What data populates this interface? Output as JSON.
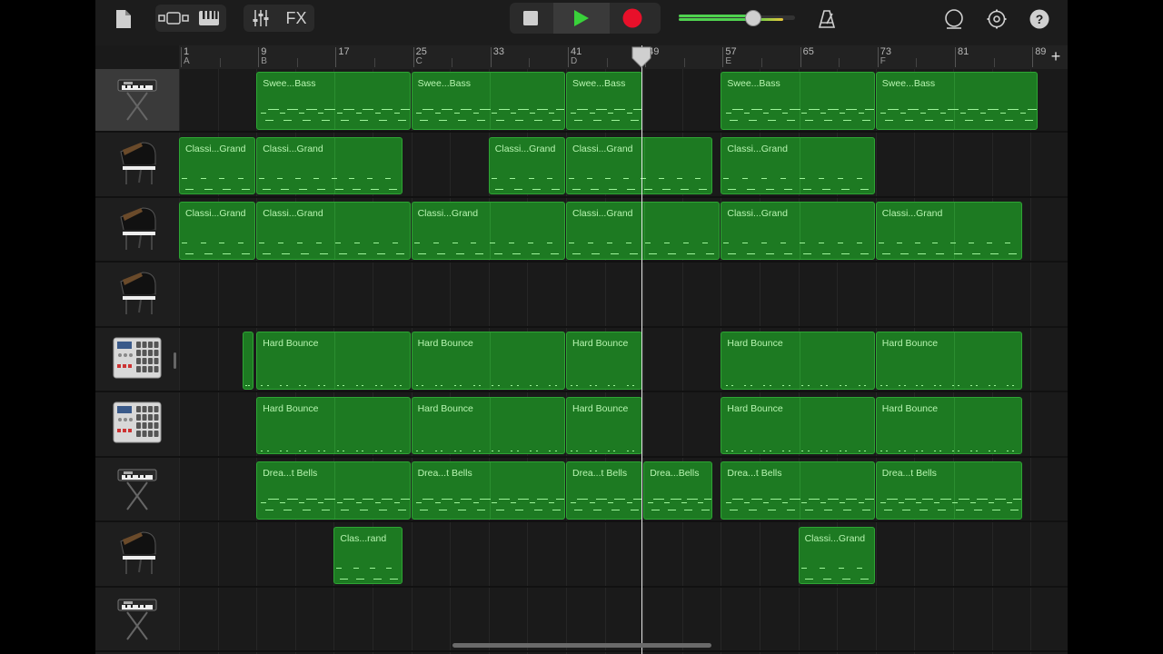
{
  "toolbar": {
    "fx_label": "FX"
  },
  "colors": {
    "region": "#1d7a22",
    "region_border": "#2ea534",
    "region_text": "#b7f5b0",
    "record": "#e8102a",
    "play": "#39d23a"
  },
  "volume_level": 0.63,
  "ruler": {
    "bars": [
      "1",
      "9",
      "17",
      "25",
      "33",
      "41",
      "49",
      "57",
      "65",
      "73",
      "81",
      "89"
    ],
    "markers": [
      "A",
      "B",
      "C",
      "D",
      "E",
      "F"
    ],
    "add_label": "+"
  },
  "tracks": [
    {
      "instrument": "keyboard-synth-icon",
      "regions": [
        {
          "name": "Swee...Bass"
        },
        {
          "name": "Swee...Bass"
        },
        {
          "name": "Swee...Bass"
        },
        {
          "name": "Swee...Bass"
        },
        {
          "name": "Swee...Bass"
        }
      ]
    },
    {
      "instrument": "grand-piano-icon",
      "regions": [
        {
          "name": "Classi...Grand"
        },
        {
          "name": "Classi...Grand"
        },
        {
          "name": "Classi...Grand"
        },
        {
          "name": "Classi...Grand"
        },
        {
          "name": "Classi...Grand"
        }
      ]
    },
    {
      "instrument": "grand-piano-icon",
      "regions": [
        {
          "name": "Classi...Grand"
        },
        {
          "name": "Classi...Grand"
        },
        {
          "name": "Classi...Grand"
        },
        {
          "name": "Classi...Grand"
        },
        {
          "name": "Classi...Grand"
        },
        {
          "name": "Classi...Grand"
        }
      ]
    },
    {
      "instrument": "grand-piano-icon",
      "regions": []
    },
    {
      "instrument": "drum-machine-icon",
      "regions": [
        {
          "name": ""
        },
        {
          "name": "Hard Bounce"
        },
        {
          "name": "Hard Bounce"
        },
        {
          "name": "Hard Bounce"
        },
        {
          "name": "Hard Bounce"
        },
        {
          "name": "Hard Bounce"
        }
      ]
    },
    {
      "instrument": "drum-machine-icon",
      "regions": [
        {
          "name": "Hard Bounce"
        },
        {
          "name": "Hard Bounce"
        },
        {
          "name": "Hard Bounce"
        },
        {
          "name": "Hard Bounce"
        },
        {
          "name": "Hard Bounce"
        }
      ]
    },
    {
      "instrument": "keyboard-synth-icon",
      "regions": [
        {
          "name": "Drea...t Bells"
        },
        {
          "name": "Drea...t Bells"
        },
        {
          "name": "Drea...t Bells"
        },
        {
          "name": "Drea...Bells"
        },
        {
          "name": "Drea...t Bells"
        },
        {
          "name": "Drea...t Bells"
        }
      ]
    },
    {
      "instrument": "grand-piano-icon",
      "regions": [
        {
          "name": "Clas...rand"
        },
        {
          "name": "Classi...Grand"
        }
      ]
    },
    {
      "instrument": "keyboard-synth-icon",
      "regions": []
    }
  ]
}
